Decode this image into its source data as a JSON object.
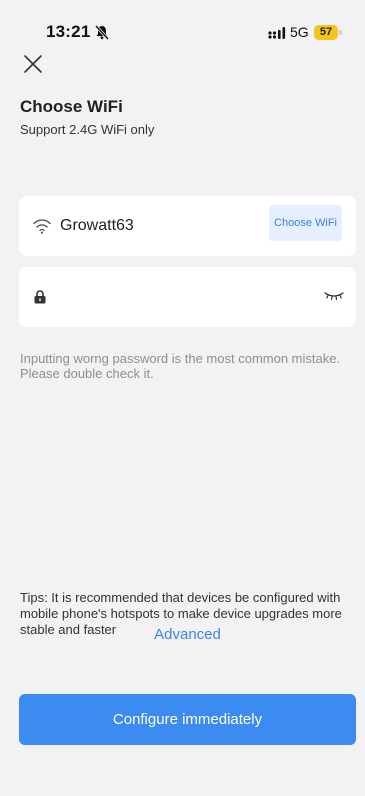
{
  "status_bar": {
    "time": "13:21",
    "network": "5G",
    "battery_level": "57",
    "battery_color": "#f5c518"
  },
  "header": {
    "close_icon": "close-icon",
    "title": "Choose WiFi",
    "subtitle": "Support 2.4G WiFi only"
  },
  "wifi": {
    "ssid": "Growatt63",
    "choose_label": "Choose WiFi",
    "icon": "wifi-icon"
  },
  "password": {
    "value": "",
    "placeholder": "",
    "lock_icon": "lock-icon",
    "toggle_icon": "eye-closed-icon"
  },
  "hint": "Inputting worng password is the most common mistake. Please double check it.",
  "tips": "Tips: It is recommended that devices be configured with mobile phone's hotspots to make device upgrades more stable and faster",
  "advanced_label": "Advanced",
  "configure_label": "Configure immediately",
  "colors": {
    "accent": "#3b8bf0",
    "link": "#3a86e8",
    "background": "#f2f2f4"
  }
}
